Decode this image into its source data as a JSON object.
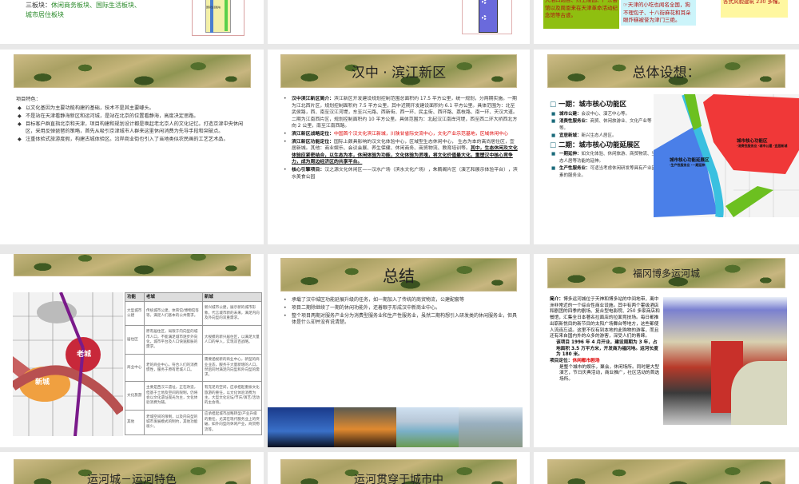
{
  "slides": {
    "top_left": {
      "line1_prefix": "三板块：",
      "line1_green": "休闲商务板块、国际生活板块、",
      "line2": "城市居住板块",
      "diagram_label": "国际生活板块"
    },
    "top_right": {
      "box_green": "大沽口炮台、烈士陵园、广东会馆以及周恩来在天津革命活动纪念馆等古迹。",
      "box_blue_title": "文化",
      "box_blue": "☞天津的小吃也闻名全国，狗不理包子、十八街麻花和耳朵眼炸糕被誉为津门三绝。",
      "box_yellow": "各式风貌建筑 230 多幢。"
    },
    "features": {
      "heading": "项目特色：",
      "bullets": [
        "以文化基因为主要功能构建的基础，技术不是其主要噱头。",
        "不是站在天津看静海新区和运河城，是站在北京的位置看静海，高度决定思路。",
        "目标客户群直指北京和天津，项目构建和规划设计都是唤起老北京人的文化记忆。打造京津中央休闲区，采用反弹琵琶的策略，首先从吸引京津城市人群来这里休闲消费为先导手段和突破点。",
        "注重体验式旅游度假，构建古城体验区。沿岸商业街也引入了当地类似农民画的工艺艺术品。"
      ]
    },
    "hanzhong": {
      "title": "汉中 · 滨江新区",
      "intro_label": "汉中滨江新区简介：",
      "intro": "滨江新区开发建设规划控制范围总面积约 17.5 平方公里，统一规划，分两期实施。一期为江北西片区，规划控制面积约 7.5 平方公里，其中近期开发建设面积约 6.1 平方公里。具体范围为：北至武侯路，西、南至汉江河堤，东至兴元路、西新街、西一环、民主街、西环路、荔枝路、南一环、天汉大道。二期为江南西片区，规划控制面积约 10 平方公里。具体范围为：北起汉江南岸河堤，西至西二环大桥西北方向 2 公里，南至江南西路。",
      "strategy_label": "滨江新区战略定位：",
      "strategy": "中国首个汉文化滨江新城，川陕甘省际交流中心，文化产业示范基地，区域休闲中心",
      "function_label": "滨江新区功能定位：",
      "function": "国际上颇具影响的汉文化体验中心，区域型生态休闲中心， 生态为本的高尚居住区，宜居新城。其他：商业娱乐、会议会展、养生保健、休闲商务、商贸物流、教育培训等。",
      "function_emph": "其中，生态休闲及文化体验应紧密结合，以生态为本，休闲体验为功能，文化体验为灵魂，将文化价值最大化，重塑汉中核心竞争力，成为周边经济区的共享平台。",
      "core_label": "核心引擎项目：",
      "core": "汉之源文化休闲区——汉水广场（滨水文化广场），朱鹮阁片区（演艺和展示体验平台），滨水美食公园"
    },
    "overall": {
      "title": "总体设想：",
      "phase1": "一期：城市核心功能区",
      "phase1_items": [
        {
          "label": "城市公建：",
          "text": "会议中心、演艺中心等。"
        },
        {
          "label": "消费性服务业：",
          "text": "商贸、休闲旅游业、文化产业等等。"
        },
        {
          "label": "宜居新城：",
          "text": "新兴生态人居区。"
        }
      ],
      "phase2": "二期：城市核心功能延展区",
      "phase2_items": [
        {
          "label": "一期延伸：",
          "text": "如文化体验、休闲旅游、商贸物流、生态人居等功能的延伸。"
        },
        {
          "label": "生产性服务业：",
          "text": "可适当考虑休闲研发等具有产业因素的服务业。"
        }
      ],
      "map_red": "城市核心功能区",
      "map_red_sub": "·消费性服务业 ·城市公建 ·宜居新城",
      "map_blue": "城市核心功能延展区",
      "map_blue_sub": "·生产性服务业 ·一期延伸"
    },
    "compare": {
      "map_old": "老城",
      "map_new": "新城",
      "headers": [
        "功能",
        "老城",
        "新城"
      ],
      "rows": [
        [
          "大型城市公建",
          "传统城市公建，体育馆/博物馆等等，满足人们基本的公共需求。",
          "新兴城市公建，展示新的城市形象，代言城市新的未来，满足内向及外向型的双重需求。"
        ],
        [
          "居住区",
          "原有居住区，局限于内向型的城市人口，不能满足城市逐步外向化，城市平台及人口快速膨胀的需求。",
          "大规模的新兴居住区，以满足大量人口的导入，实现双百战略。"
        ],
        [
          "商业中心",
          "老的商业中心，符合人们的消费惯性，服务于原有老城人口。",
          "需要涵视新的商业中心，新型的商业业态，服务于大量新增的人口，然后同时满足内向型和外向型的需求。"
        ],
        [
          "文化旅游",
          "主要是西汉三遗址，正在改造，但基于土地及空间的限制，仍将会以文化遗址观光为主，文化体验消费为辅。",
          "有充足的空间，应承担起重振文化旅游的重任，以文化体验消费为主，大型文化论坛/节庆/演艺/活动的主会场。"
        ],
        [
          "其他",
          "老城空间的限制，以及内向型的城市发展模式的制约，其他功能很少。",
          "应承担起城市战略转型/产业升级的重任，尤其在现代服务业上的突破，如外向型的休闲产业，商贸物流等。"
        ]
      ]
    },
    "summary": {
      "title": "总结",
      "bullets": [
        "承载了汉中城区功能延展升级的任务，如一期加入了传统的商贸物流，公建配套等",
        "项目二期除继续了一期的休闲功能外，还着眼于形成汉中新商业中心。",
        "整个项目两期对服务产业分为消费型服务业和生产性服务业，虽然二期构想引入研发类的休闲服务业，但具体是什么却并没有说清楚。"
      ]
    },
    "fukuoka": {
      "title": "福冈博多运河城",
      "intro_label": "简介：",
      "intro": "博多运河城位于天神和博多站的中间地带，离中洲非常近的一个综合性商业设施。其中有两个霍级酒店和剧团的四季的剧场、复合型电影院、250 多家商店和餐馆，汇集全日本著名拉面店的拉面竞技场。每日都推出崭新悦目的新节目的太阳广场舞台等地方，这些都使人流连忘返。这里不仅有到本地的此购物的游客，而且还有来自国内外的众多的游客，深受人们的青睐。",
      "facts": "该项目 1996 年 4 月开业，建设周期为 3 年，占地面积 3.5 万平方米，开发商为福冈地。运河长度为 180 米。",
      "position_label": "项目定位：",
      "position": "休闲都市剧场",
      "position_desc": "是整个城市的娱乐，聚会，休闲场所。同时是大型演艺，节日庆典活动，商业推广，社区活动的首选场所。"
    },
    "bottom": {
      "t1": "运河城－运河特色",
      "t2": "运河贯穿于城市中"
    }
  }
}
